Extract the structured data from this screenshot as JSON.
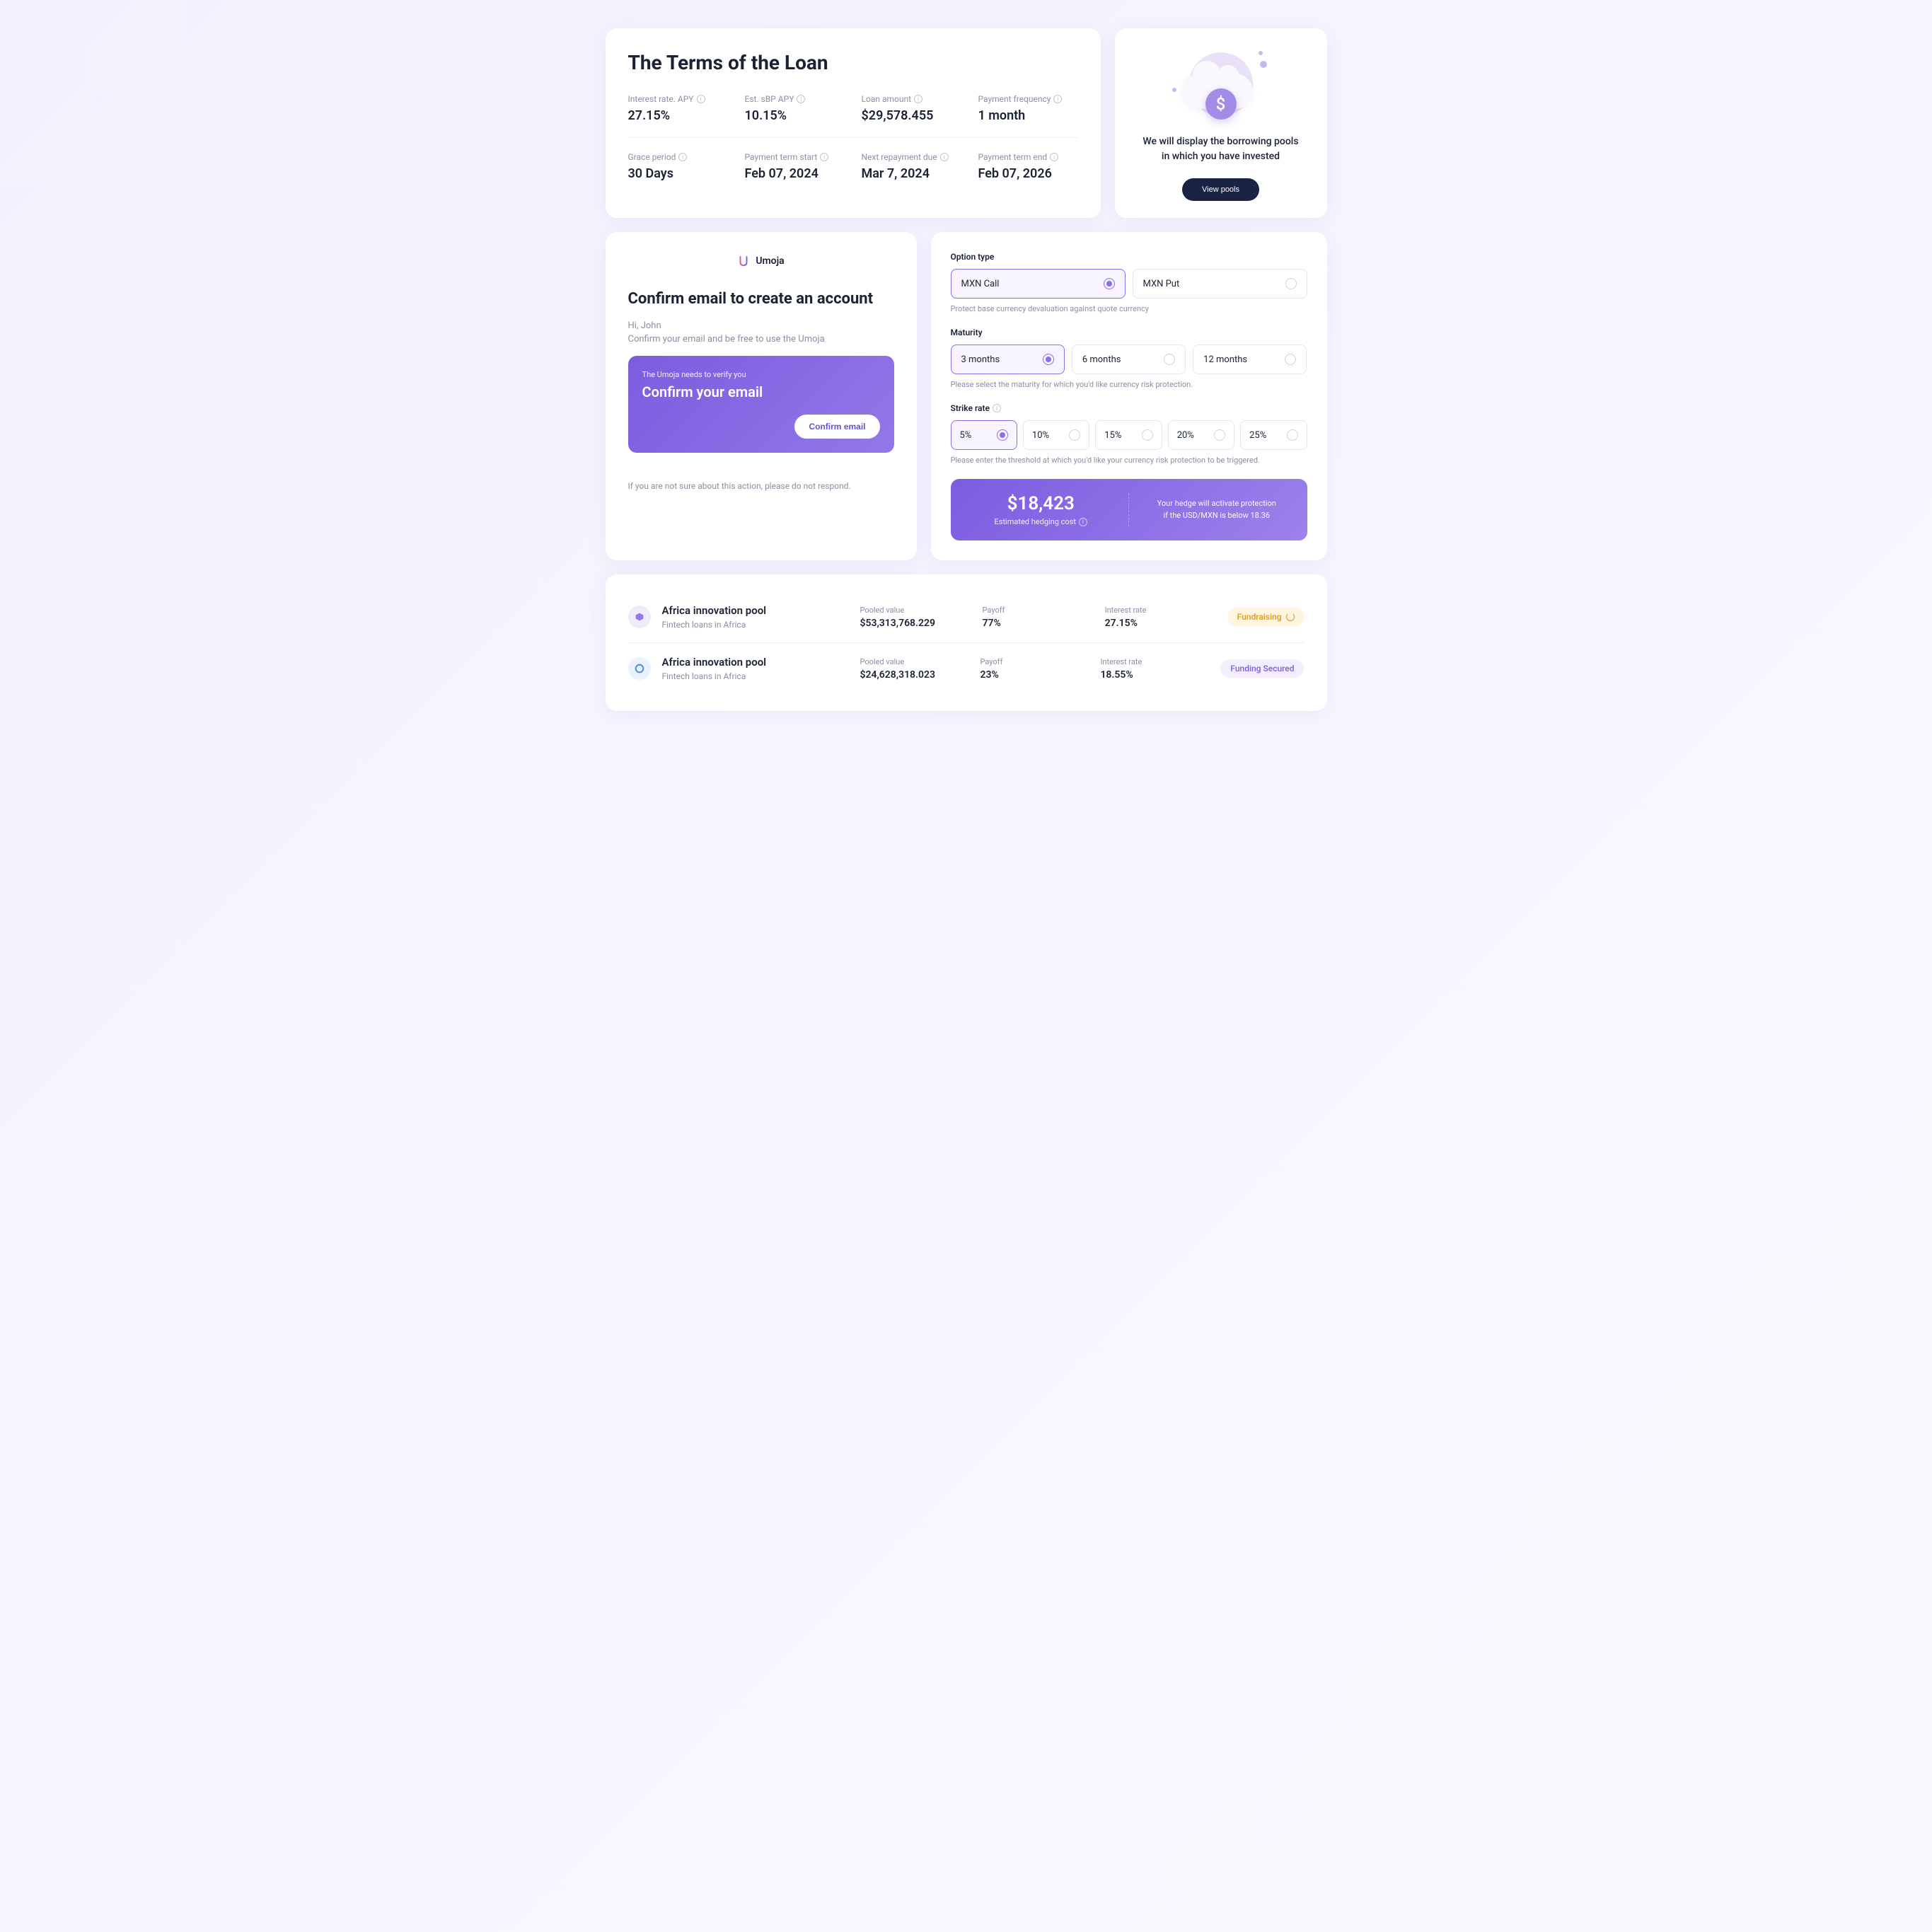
{
  "loanTerms": {
    "title": "The Terms of the Loan",
    "items": [
      {
        "label": "Interest rate. APY",
        "value": "27.15%",
        "info": true
      },
      {
        "label": "Est. sBP APY",
        "value": "10.15%",
        "info": true
      },
      {
        "label": "Loan amount",
        "value": "$29,578.455",
        "info": true
      },
      {
        "label": "Payment frequency",
        "value": "1 month",
        "info": true
      },
      {
        "label": "Grace period",
        "value": "30 Days",
        "info": true
      },
      {
        "label": "Payment term start",
        "value": "Feb 07, 2024",
        "info": true
      },
      {
        "label": "Next repayment due",
        "value": "Mar 7, 2024",
        "info": true
      },
      {
        "label": "Payment term end",
        "value": "Feb 07, 2026",
        "info": true
      }
    ]
  },
  "poolsCard": {
    "text1": "We will display the borrowing pools",
    "text2": "in which you have invested",
    "button": "View pools"
  },
  "email": {
    "brand": "Umoja",
    "title": "Confirm email to create an account",
    "greeting": "Hi, John",
    "subtext": "Confirm your email and be free to use the Umoja",
    "box": {
      "small": "The Umoja needs to verify you",
      "big": "Confirm your email",
      "button": "Confirm email"
    },
    "footer": "If you are not sure about this action, please do not respond."
  },
  "options": {
    "optionType": {
      "label": "Option type",
      "options": [
        "MXN Call",
        "MXN Put"
      ],
      "selected": 0,
      "hint": "Protect base currency devaluation against quote currency"
    },
    "maturity": {
      "label": "Maturity",
      "options": [
        "3 months",
        "6 months",
        "12 months"
      ],
      "selected": 0,
      "hint": "Please select the maturity for which you'd like currency risk protection."
    },
    "strikeRate": {
      "label": "Strike rate",
      "options": [
        "5%",
        "10%",
        "15%",
        "20%",
        "25%"
      ],
      "selected": 0,
      "hint": "Please enter the threshold at which you'd like your currency risk protection to be triggered."
    },
    "hedge": {
      "amount": "$18,423",
      "label": "Estimated hedging cost",
      "text1": "Your hedge will activate protection",
      "text2": "if the USD/MXN is below 18.36"
    }
  },
  "poolList": [
    {
      "name": "Africa innovation pool",
      "desc": "Fintech loans in Africa",
      "pooledLabel": "Pooled value",
      "pooled": "$53,313,768.229",
      "payoffLabel": "Payoff",
      "payoff": "77%",
      "rateLabel": "Interest rate",
      "rate": "27.15%",
      "badge": "Fundraising",
      "badgeType": "fundraising"
    },
    {
      "name": "Africa innovation pool",
      "desc": "Fintech loans in Africa",
      "pooledLabel": "Pooled value",
      "pooled": "$24,628,318.023",
      "payoffLabel": "Payoff",
      "payoff": "23%",
      "rateLabel": "Interest rate",
      "rate": "18.55%",
      "badge": "Funding Secured",
      "badgeType": "secured"
    }
  ]
}
